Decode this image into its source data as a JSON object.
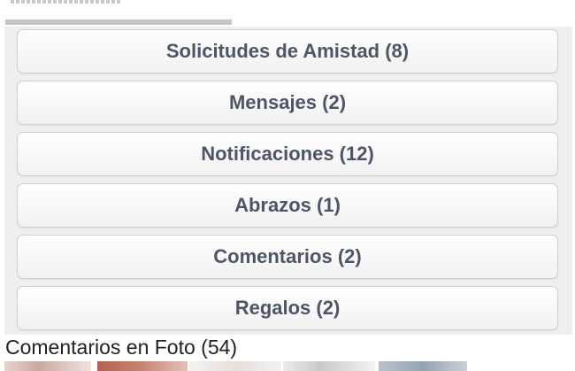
{
  "notifications": {
    "items": [
      {
        "label": "Solicitudes de Amistad (8)"
      },
      {
        "label": "Mensajes (2)"
      },
      {
        "label": "Notificaciones (12)"
      },
      {
        "label": "Abrazos (1)"
      },
      {
        "label": "Comentarios (2)"
      },
      {
        "label": "Regalos (2)"
      }
    ]
  },
  "photo_comments": {
    "title": "Comentarios en Foto (54)"
  },
  "colors": {
    "button_text": "#4d5566",
    "panel_bg": "#eeeeee",
    "button_border": "#cfcfcf"
  }
}
